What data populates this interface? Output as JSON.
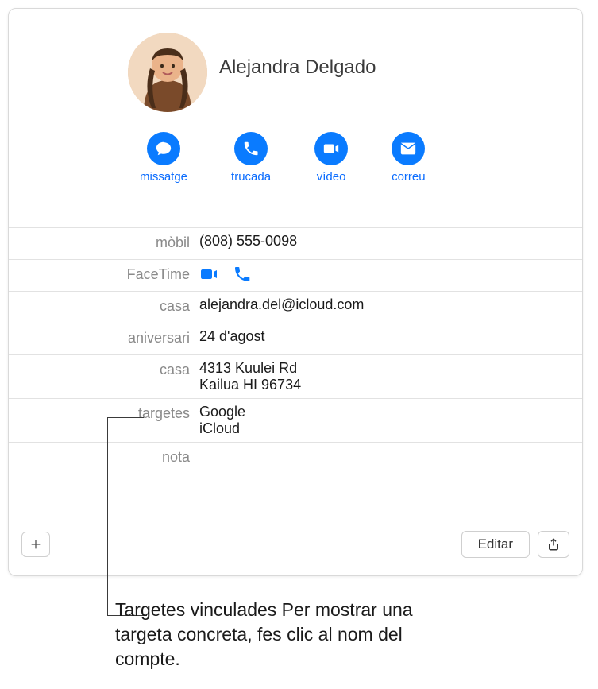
{
  "contact": {
    "name": "Alejandra Delgado"
  },
  "actions": {
    "message": "missatge",
    "call": "trucada",
    "video": "vídeo",
    "mail": "correu"
  },
  "fields": {
    "mobile_label": "mòbil",
    "mobile_value": "(808) 555-0098",
    "facetime_label": "FaceTime",
    "home_email_label": "casa",
    "home_email_value": "alejandra.del@icloud.com",
    "anniversary_label": "aniversari",
    "anniversary_value": "24 d'agost",
    "home_addr_label": "casa",
    "home_addr_line1": "4313 Kuulei Rd",
    "home_addr_line2": "Kailua HI 96734",
    "cards_label": "targetes",
    "card_google": "Google",
    "card_icloud": "iCloud",
    "note_label": "nota"
  },
  "footer": {
    "edit": "Editar"
  },
  "callout": "Targetes vinculades Per mostrar una targeta concreta, fes clic al nom del compte."
}
